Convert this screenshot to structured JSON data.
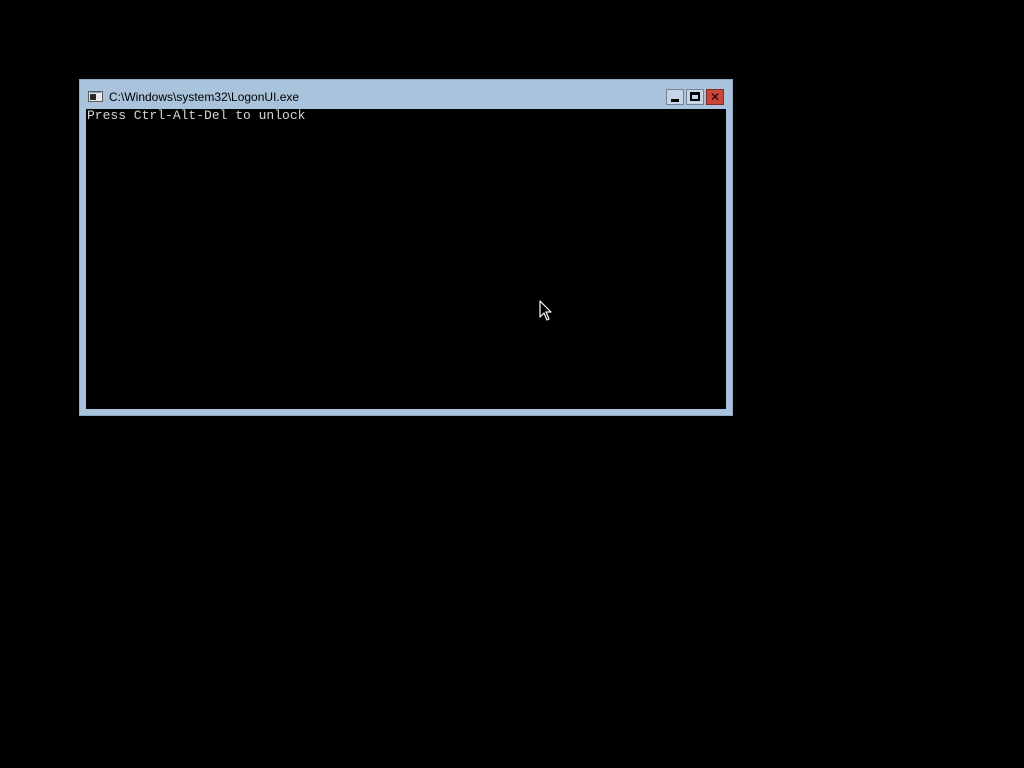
{
  "window": {
    "title": "C:\\Windows\\system32\\LogonUI.exe",
    "icon": "console-icon",
    "controls": {
      "minimize_icon": "minimize-icon",
      "maximize_icon": "maximize-icon",
      "close_glyph": "✕"
    }
  },
  "console": {
    "text": "Press Ctrl-Alt-Del to unlock"
  },
  "colors": {
    "frame": "#a9c3dc",
    "close_button": "#c8463a",
    "console_background": "#000000",
    "console_text": "#d4d4d4"
  }
}
